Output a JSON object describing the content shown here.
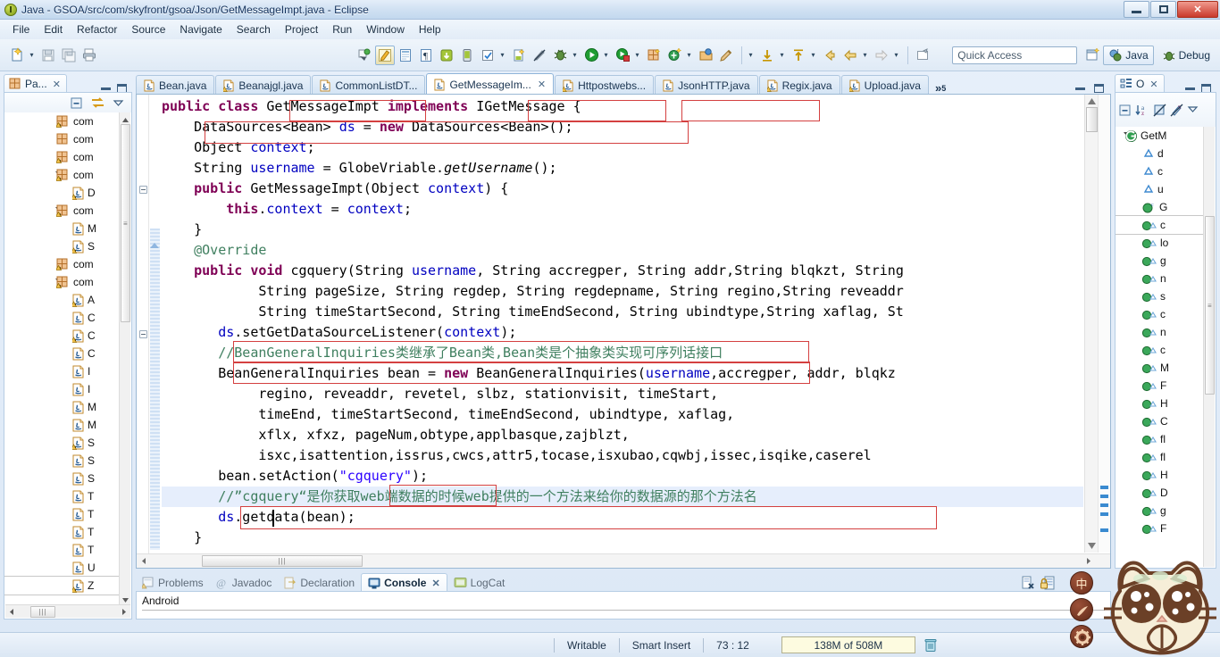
{
  "window": {
    "title": "Java - GSOA/src/com/skyfront/gsoa/Json/GetMessageImpt.java - Eclipse",
    "app_icon": "eclipse-icon",
    "minimize_label": "",
    "maximize_label": "",
    "close_label": "✕"
  },
  "menubar": {
    "items": [
      {
        "label": "File"
      },
      {
        "label": "Edit"
      },
      {
        "label": "Refactor"
      },
      {
        "label": "Source"
      },
      {
        "label": "Navigate"
      },
      {
        "label": "Search"
      },
      {
        "label": "Project"
      },
      {
        "label": "Run"
      },
      {
        "label": "Window"
      },
      {
        "label": "Help"
      }
    ]
  },
  "toolbar": {
    "left_icons": [
      {
        "name": "new-wizard-icon"
      },
      {
        "name": "new-wizard-dropdown-icon"
      },
      {
        "name": "save-icon"
      },
      {
        "name": "save-all-icon"
      },
      {
        "name": "print-icon"
      }
    ],
    "mid_icons": [
      {
        "name": "toggle-mark-occurrences-icon"
      },
      {
        "name": "android-sdk-manager-icon"
      },
      {
        "name": "android-virtual-device-manager-icon"
      },
      {
        "name": "open-type-icon"
      },
      {
        "name": "new-java-project-icon"
      },
      {
        "name": "android-download-icon"
      },
      {
        "name": "android-device-icon"
      },
      {
        "name": "check-icon"
      },
      {
        "name": "check-dropdown-icon"
      },
      {
        "name": "new-android-activity-icon"
      },
      {
        "name": "skip-breakpoints-icon"
      },
      {
        "name": "debug-icon"
      },
      {
        "name": "debug-dropdown-icon"
      },
      {
        "name": "run-icon"
      },
      {
        "name": "run-dropdown-icon"
      },
      {
        "name": "run-external-tools-icon"
      },
      {
        "name": "run-external-dropdown-icon"
      },
      {
        "name": "new-package-icon"
      },
      {
        "name": "new-class-icon"
      },
      {
        "name": "new-class-dropdown-icon"
      },
      {
        "name": "open-perspective-icon"
      },
      {
        "name": "pencil-icon"
      }
    ],
    "right_icons": [
      {
        "name": "previous-annotation-dropdown-icon"
      },
      {
        "name": "next-annotation-icon"
      },
      {
        "name": "next-annotation-dropdown-icon"
      },
      {
        "name": "previous-annotation-icon"
      },
      {
        "name": "previous-annotation-menu-icon"
      },
      {
        "name": "back-icon"
      },
      {
        "name": "back-dropdown-icon"
      },
      {
        "name": "forward-icon"
      },
      {
        "name": "forward-dropdown-icon"
      },
      {
        "name": "pin-editor-icon"
      }
    ],
    "quick_access_placeholder": "Quick Access",
    "open_perspective_icon": "open-perspective-icon",
    "perspectives": [
      {
        "label": "Java",
        "icon": "java-perspective-icon",
        "active": true
      },
      {
        "label": "Debug",
        "icon": "debug-perspective-icon",
        "active": false
      }
    ]
  },
  "package_explorer": {
    "tab_label": "Pa...",
    "tab_icon": "package-explorer-icon",
    "close_icon": "close-icon",
    "minimize_icon": "minimize-icon",
    "maximize_icon": "maximize-icon",
    "toolbar_icons": [
      {
        "name": "collapse-all-icon"
      },
      {
        "name": "link-with-editor-icon"
      },
      {
        "name": "view-menu-icon"
      }
    ],
    "nodes": [
      {
        "indent": 0,
        "twisty": "closed",
        "icon": "package-warning-icon",
        "label": "com"
      },
      {
        "indent": 0,
        "twisty": "closed",
        "icon": "package-icon",
        "label": "com"
      },
      {
        "indent": 0,
        "twisty": "closed",
        "icon": "package-warning-icon",
        "label": "com"
      },
      {
        "indent": 0,
        "twisty": "open",
        "icon": "package-warning-icon",
        "label": "com"
      },
      {
        "indent": 1,
        "twisty": "closed",
        "icon": "java-warning-icon",
        "label": "D"
      },
      {
        "indent": 0,
        "twisty": "open",
        "icon": "package-warning-icon",
        "label": "com"
      },
      {
        "indent": 1,
        "twisty": "closed",
        "icon": "java-icon",
        "label": "M"
      },
      {
        "indent": 1,
        "twisty": "closed",
        "icon": "java-warning-icon",
        "label": "S"
      },
      {
        "indent": 0,
        "twisty": "closed",
        "icon": "package-warning-icon",
        "label": "com"
      },
      {
        "indent": 0,
        "twisty": "open",
        "icon": "package-warning-icon",
        "label": "com"
      },
      {
        "indent": 1,
        "twisty": "closed",
        "icon": "java-warning-icon",
        "label": "A"
      },
      {
        "indent": 1,
        "twisty": "closed",
        "icon": "java-icon",
        "label": "C"
      },
      {
        "indent": 1,
        "twisty": "closed",
        "icon": "java-warning-icon",
        "label": "C"
      },
      {
        "indent": 1,
        "twisty": "closed",
        "icon": "java-icon",
        "label": "C"
      },
      {
        "indent": 1,
        "twisty": "closed",
        "icon": "java-icon",
        "label": "I"
      },
      {
        "indent": 1,
        "twisty": "closed",
        "icon": "java-icon",
        "label": "I"
      },
      {
        "indent": 1,
        "twisty": "closed",
        "icon": "java-icon",
        "label": "M"
      },
      {
        "indent": 1,
        "twisty": "closed",
        "icon": "java-icon",
        "label": "M"
      },
      {
        "indent": 1,
        "twisty": "closed",
        "icon": "java-warning-icon",
        "label": "S"
      },
      {
        "indent": 1,
        "twisty": "closed",
        "icon": "java-icon",
        "label": "S"
      },
      {
        "indent": 1,
        "twisty": "closed",
        "icon": "java-icon",
        "label": "S"
      },
      {
        "indent": 1,
        "twisty": "closed",
        "icon": "java-icon",
        "label": "T"
      },
      {
        "indent": 1,
        "twisty": "closed",
        "icon": "java-icon",
        "label": "T"
      },
      {
        "indent": 1,
        "twisty": "closed",
        "icon": "java-icon",
        "label": "T"
      },
      {
        "indent": 1,
        "twisty": "closed",
        "icon": "java-icon",
        "label": "T"
      },
      {
        "indent": 1,
        "twisty": "closed",
        "icon": "java-icon",
        "label": "U"
      },
      {
        "indent": 1,
        "twisty": "closed",
        "icon": "java-warning-icon",
        "label": "Z",
        "selected": true
      }
    ]
  },
  "editor": {
    "tabs": [
      {
        "label": "Bean.java",
        "icon": "java-file-icon",
        "active": false,
        "closable": false
      },
      {
        "label": "Beanajgl.java",
        "icon": "java-warning-file-icon",
        "active": false,
        "closable": false
      },
      {
        "label": "CommonListDT...",
        "icon": "java-file-icon",
        "active": false,
        "closable": false
      },
      {
        "label": "GetMessageIm...",
        "icon": "java-file-icon",
        "active": true,
        "closable": true
      },
      {
        "label": "Httpostwebs...",
        "icon": "java-warning-file-icon",
        "active": false,
        "closable": false
      },
      {
        "label": "JsonHTTP.java",
        "icon": "java-file-icon",
        "active": false,
        "closable": false
      },
      {
        "label": "Regix.java",
        "icon": "java-warning-file-icon",
        "active": false,
        "closable": false
      },
      {
        "label": "Upload.java",
        "icon": "java-warning-file-icon",
        "active": false,
        "closable": false
      }
    ],
    "more_tabs_label": "»",
    "more_tabs_count": "5",
    "restore_icon": "restore-icon",
    "maximize_icon": "maximize-icon",
    "code_lines": [
      "public class GetMessageImpt implements IGetMessage {",
      "    DataSources<Bean> ds = new DataSources<Bean>();",
      "    Object context;",
      "    String username = GlobeVriable.getUsername();",
      "    public GetMessageImpt(Object context) {",
      "        this.context = context;",
      "    }",
      "    @Override",
      "    public void cgquery(String username, String accregper, String addr,String blqkzt, String",
      "            String pageSize, String regdep, String regdepname, String regino,String reveaddr",
      "            String timeStartSecond, String timeEndSecond, String ubindtype,String xaflag, St",
      "       ds.setGetDataSourceListener(context);",
      "       //BeanGeneralInquiries类继承了Bean类,Bean类是个抽象类实现可序列话接口",
      "       BeanGeneralInquiries bean = new BeanGeneralInquiries(username,accregper, addr, blqkz",
      "            regino, reveaddr, revetel, slbz, stationvisit, timeStart,",
      "            timeEnd, timeStartSecond, timeEndSecond, ubindtype, xaflag,",
      "            xflx, xfxz, pageNum,obtype,applbasque,zajblzt,",
      "            isxc,isattention,issrus,cwcs,attr5,tocase,isxubao,cqwbj,issec,isqike,caserel",
      "       bean.setAction(\"cgquery\");",
      "       //”cgquery“是你获取web端数据的时候web提供的一个方法来给你的数据源的那个方法名",
      "       ds.getdata(bean);",
      "    }"
    ],
    "highlighted_line_index": 19,
    "caret_text": "|"
  },
  "outline": {
    "tab_label": "O",
    "tab_icon": "outline-icon",
    "close_icon": "close-icon",
    "minimize_icon": "minimize-icon",
    "maximize_icon": "maximize-icon",
    "toolbar_icons": [
      {
        "name": "collapse-all-icon"
      },
      {
        "name": "sort-alphabetically-icon"
      },
      {
        "name": "hide-fields-icon"
      },
      {
        "name": "hide-static-icon"
      },
      {
        "name": "hide-non-public-icon"
      },
      {
        "name": "view-menu-icon"
      }
    ],
    "nodes": [
      {
        "indent": 0,
        "twisty": "open",
        "icon": "class-icon",
        "label": "GetM"
      },
      {
        "indent": 1,
        "twisty": "none",
        "icon": "field-icon",
        "label": "d"
      },
      {
        "indent": 1,
        "twisty": "none",
        "icon": "field-icon",
        "label": "c"
      },
      {
        "indent": 1,
        "twisty": "none",
        "icon": "field-icon",
        "label": "u"
      },
      {
        "indent": 1,
        "twisty": "none",
        "icon": "constructor-icon",
        "label": "G"
      },
      {
        "indent": 1,
        "twisty": "none",
        "icon": "method-override-icon",
        "label": "c",
        "selected": true
      },
      {
        "indent": 1,
        "twisty": "none",
        "icon": "method-override-icon",
        "label": "lo"
      },
      {
        "indent": 1,
        "twisty": "none",
        "icon": "method-override-icon",
        "label": "g"
      },
      {
        "indent": 1,
        "twisty": "none",
        "icon": "method-override-icon",
        "label": "n"
      },
      {
        "indent": 1,
        "twisty": "none",
        "icon": "method-override-icon",
        "label": "s"
      },
      {
        "indent": 1,
        "twisty": "none",
        "icon": "method-override-icon",
        "label": "c"
      },
      {
        "indent": 1,
        "twisty": "none",
        "icon": "method-override-icon",
        "label": "n"
      },
      {
        "indent": 1,
        "twisty": "none",
        "icon": "method-override-icon",
        "label": "c"
      },
      {
        "indent": 1,
        "twisty": "none",
        "icon": "method-override-icon",
        "label": "M"
      },
      {
        "indent": 1,
        "twisty": "none",
        "icon": "method-override-icon",
        "label": "F"
      },
      {
        "indent": 1,
        "twisty": "none",
        "icon": "method-override-icon",
        "label": "H"
      },
      {
        "indent": 1,
        "twisty": "none",
        "icon": "method-override-icon",
        "label": "C"
      },
      {
        "indent": 1,
        "twisty": "none",
        "icon": "method-override-icon",
        "label": "fl"
      },
      {
        "indent": 1,
        "twisty": "none",
        "icon": "method-override-icon",
        "label": "fl"
      },
      {
        "indent": 1,
        "twisty": "none",
        "icon": "method-override-icon",
        "label": "H"
      },
      {
        "indent": 1,
        "twisty": "none",
        "icon": "method-override-icon",
        "label": "D"
      },
      {
        "indent": 1,
        "twisty": "none",
        "icon": "method-override-icon",
        "label": "g"
      },
      {
        "indent": 1,
        "twisty": "none",
        "icon": "method-override-icon",
        "label": "F"
      }
    ]
  },
  "bottom_panel": {
    "tabs": [
      {
        "label": "Problems",
        "icon": "problems-icon",
        "active": false
      },
      {
        "label": "Javadoc",
        "icon": "javadoc-icon",
        "active": false
      },
      {
        "label": "Declaration",
        "icon": "declaration-icon",
        "active": false
      },
      {
        "label": "Console",
        "icon": "console-icon",
        "active": true,
        "closable": true
      },
      {
        "label": "LogCat",
        "icon": "logcat-icon",
        "active": false
      }
    ],
    "ctrl_icons": [
      {
        "name": "clear-console-icon"
      },
      {
        "name": "scroll-lock-icon"
      }
    ],
    "console_text": "Android"
  },
  "statusbar": {
    "writable": "Writable",
    "insert_mode": "Smart Insert",
    "cursor_position": "73 : 12",
    "memory": "138M of 508M",
    "trash_icon": "trash-icon"
  },
  "ime_widget": {
    "language_label": "中",
    "buttons": [
      {
        "name": "ime-language-toggle",
        "label": "中"
      },
      {
        "name": "ime-handwriting-button",
        "label": ""
      },
      {
        "name": "ime-settings-button",
        "label": ""
      }
    ],
    "mascot": "sogou-cat-mascot"
  },
  "colors": {
    "keyword": "#7f0055",
    "string": "#2a00ff",
    "comment": "#3f7f5f",
    "field": "#0000c0",
    "annotation_box": "#d44040",
    "selection": "#e6eefc",
    "chrome": "#dce8f6"
  }
}
